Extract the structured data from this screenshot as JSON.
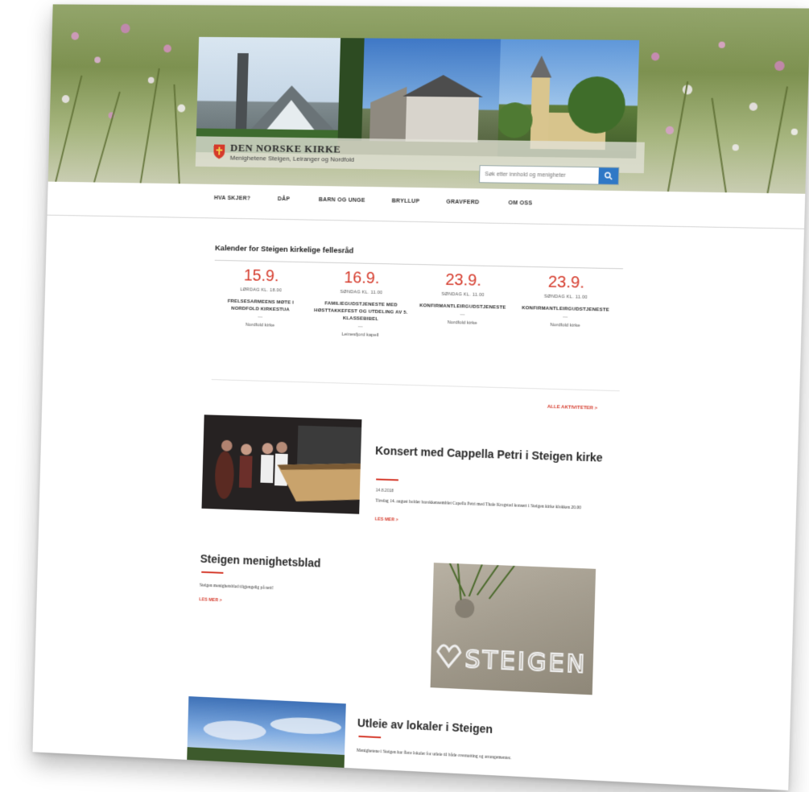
{
  "colors": {
    "accent": "#d53a2b",
    "search_button": "#2f78c6",
    "text": "#2a2a2a"
  },
  "brand": {
    "title": "DEN NORSKE KIRKE",
    "subtitle": "Menighetene Steigen, Leiranger og Nordfold",
    "logo_icon": "church-shield-icon"
  },
  "search": {
    "placeholder": "Søk etter innhold og menigheter",
    "icon": "search-icon"
  },
  "nav": [
    "HVA SKJER?",
    "DÅP",
    "BARN OG UNGE",
    "BRYLLUP",
    "GRAVFERD",
    "OM OSS"
  ],
  "calendar": {
    "title": "Kalender for Steigen kirkelige fellesråd",
    "events": [
      {
        "date": "15.9.",
        "time": "LØRDAG KL. 18.00",
        "name": "FRELSESARMEENS MØTE I NORDFOLD KIRKESTUA",
        "location": "Nordfold kirke"
      },
      {
        "date": "16.9.",
        "time": "SØNDAG KL. 11.00",
        "name": "FAMILIEGUDSTJENESTE MED HØSTTAKKEFEST OG UTDELING AV 5. KLASSEBIBEL",
        "location": "Leinesfjord kapell"
      },
      {
        "date": "23.9.",
        "time": "SØNDAG KL. 11.00",
        "name": "KONFIRMANTLEIRGUDSTJENESTE",
        "location": "Nordfold kirke"
      },
      {
        "date": "23.9.",
        "time": "SØNDAG KL. 11.00",
        "name": "KONFIRMANTLEIRGUDSTJENESTE",
        "location": "Nordfold kirke"
      }
    ],
    "all_link": "ALLE AKTIVITETER >"
  },
  "articles": [
    {
      "title": "Konsert med Cappella Petri i Steigen kirke",
      "date": "14.8.2018",
      "text": "Tirsdag 14. august holder barokkensemblet Capella Petri med Thale Krogstad konsert i Steigen kirke klokken 20.00",
      "more": "LES MER >"
    },
    {
      "title": "Steigen menighetsblad",
      "text": "Steigen menighetsblad tilgjengelig på nett!",
      "more": "LES MER >"
    },
    {
      "title": "Utleie av lokaler i Steigen",
      "text": "Menighetene i Steigen har flere lokaler for utleie til både overnatting og arrangementer."
    }
  ],
  "images": {
    "sand_writing": "STEIGEN"
  }
}
